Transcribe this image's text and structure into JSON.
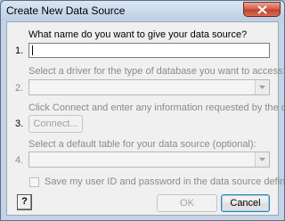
{
  "window": {
    "title": "Create New Data Source"
  },
  "steps": [
    {
      "number": "1.",
      "prompt": "What name do you want to give your data source?",
      "value": ""
    },
    {
      "number": "2.",
      "prompt": "Select a driver for the type of database you want to access:",
      "value": ""
    },
    {
      "number": "3.",
      "prompt": "Click Connect and enter any information requested by the driver:",
      "button_label": "Connect..."
    },
    {
      "number": "4.",
      "prompt": "Select a default table for your data source (optional):",
      "value": ""
    }
  ],
  "save_password": {
    "label": "Save my user ID and password in the data source definition",
    "checked": false
  },
  "buttons": {
    "help": "?",
    "ok": "OK",
    "cancel": "Cancel"
  }
}
